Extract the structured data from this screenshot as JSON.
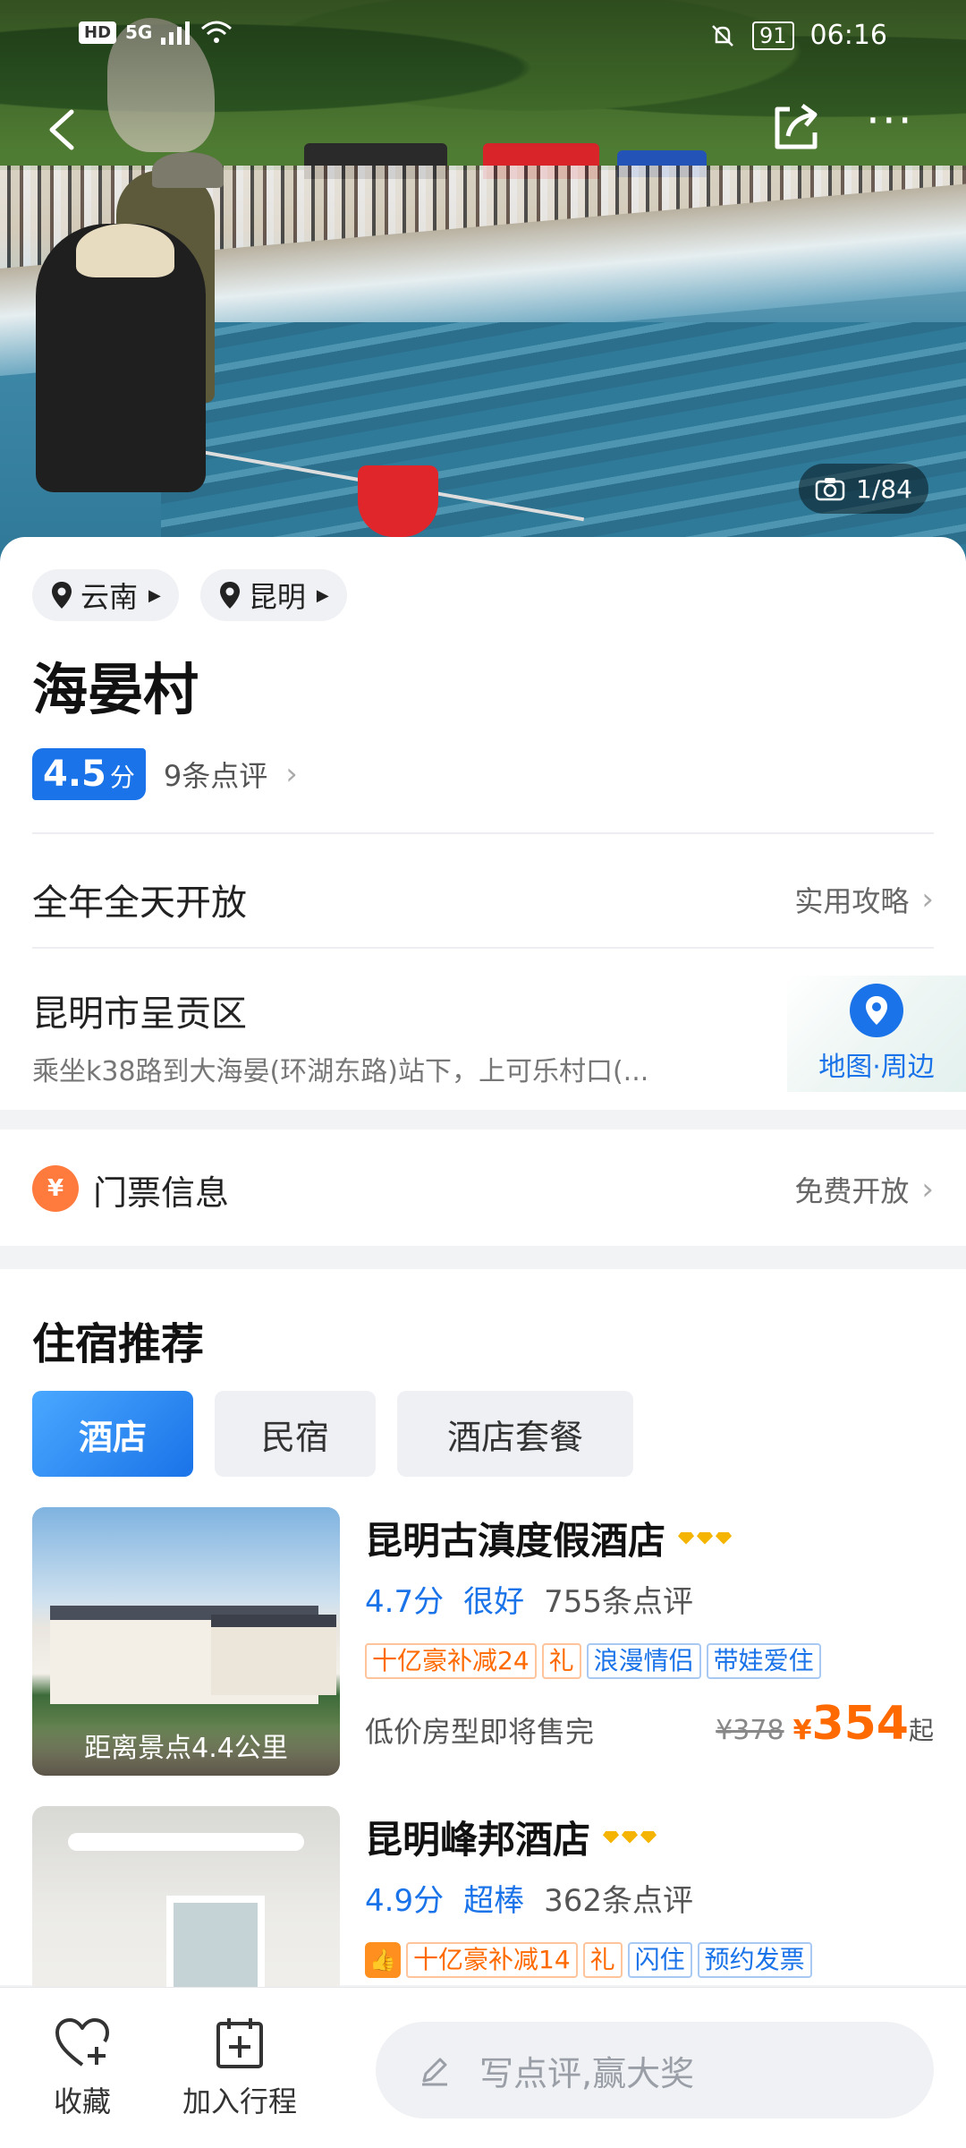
{
  "status_bar": {
    "network": "HD",
    "signal": "5G",
    "battery": "91",
    "time": "06:16"
  },
  "header": {
    "photo_counter": "1/84"
  },
  "breadcrumbs": [
    {
      "label": "云南"
    },
    {
      "label": "昆明"
    }
  ],
  "poi": {
    "title": "海晏村",
    "score": "4.5",
    "score_unit": "分",
    "review_count": "9条点评",
    "hours": "全年全天开放",
    "guide_label": "实用攻略",
    "district": "昆明市呈贡区",
    "route": "乘坐k38路到大海晏(环湖东路)站下，上可乐村口(...",
    "map_label": "地图·周边"
  },
  "ticket": {
    "icon": "¥",
    "title": "门票信息",
    "status": "免费开放"
  },
  "lodging": {
    "title": "住宿推荐",
    "tabs": [
      {
        "label": "酒店",
        "active": true
      },
      {
        "label": "民宿",
        "active": false
      },
      {
        "label": "酒店套餐",
        "active": false
      }
    ],
    "hotels": [
      {
        "name": "昆明古滇度假酒店",
        "diamonds": 3,
        "score": "4.7分",
        "level": "很好",
        "reviews": "755条点评",
        "tags": [
          "十亿豪补减24",
          "礼",
          "浪漫情侣",
          "带娃爱住"
        ],
        "distance": "距离景点4.4公里",
        "note": "低价房型即将售完",
        "old_price": "¥378",
        "currency": "¥",
        "price": "354",
        "price_suffix": "起"
      },
      {
        "name": "昆明峰邦酒店",
        "diamonds": 3,
        "score": "4.9分",
        "level": "超棒",
        "reviews": "362条点评",
        "tags": [
          "十亿豪补减14",
          "礼",
          "闪住",
          "预约发票"
        ]
      }
    ]
  },
  "bottom_bar": {
    "favorite_label": "收藏",
    "add_trip_label": "加入行程",
    "review_placeholder": "写点评,赢大奖"
  },
  "colors": {
    "accent": "#1a73e8",
    "price": "#ff6a00",
    "ticket_icon": "#ff7a3d"
  }
}
